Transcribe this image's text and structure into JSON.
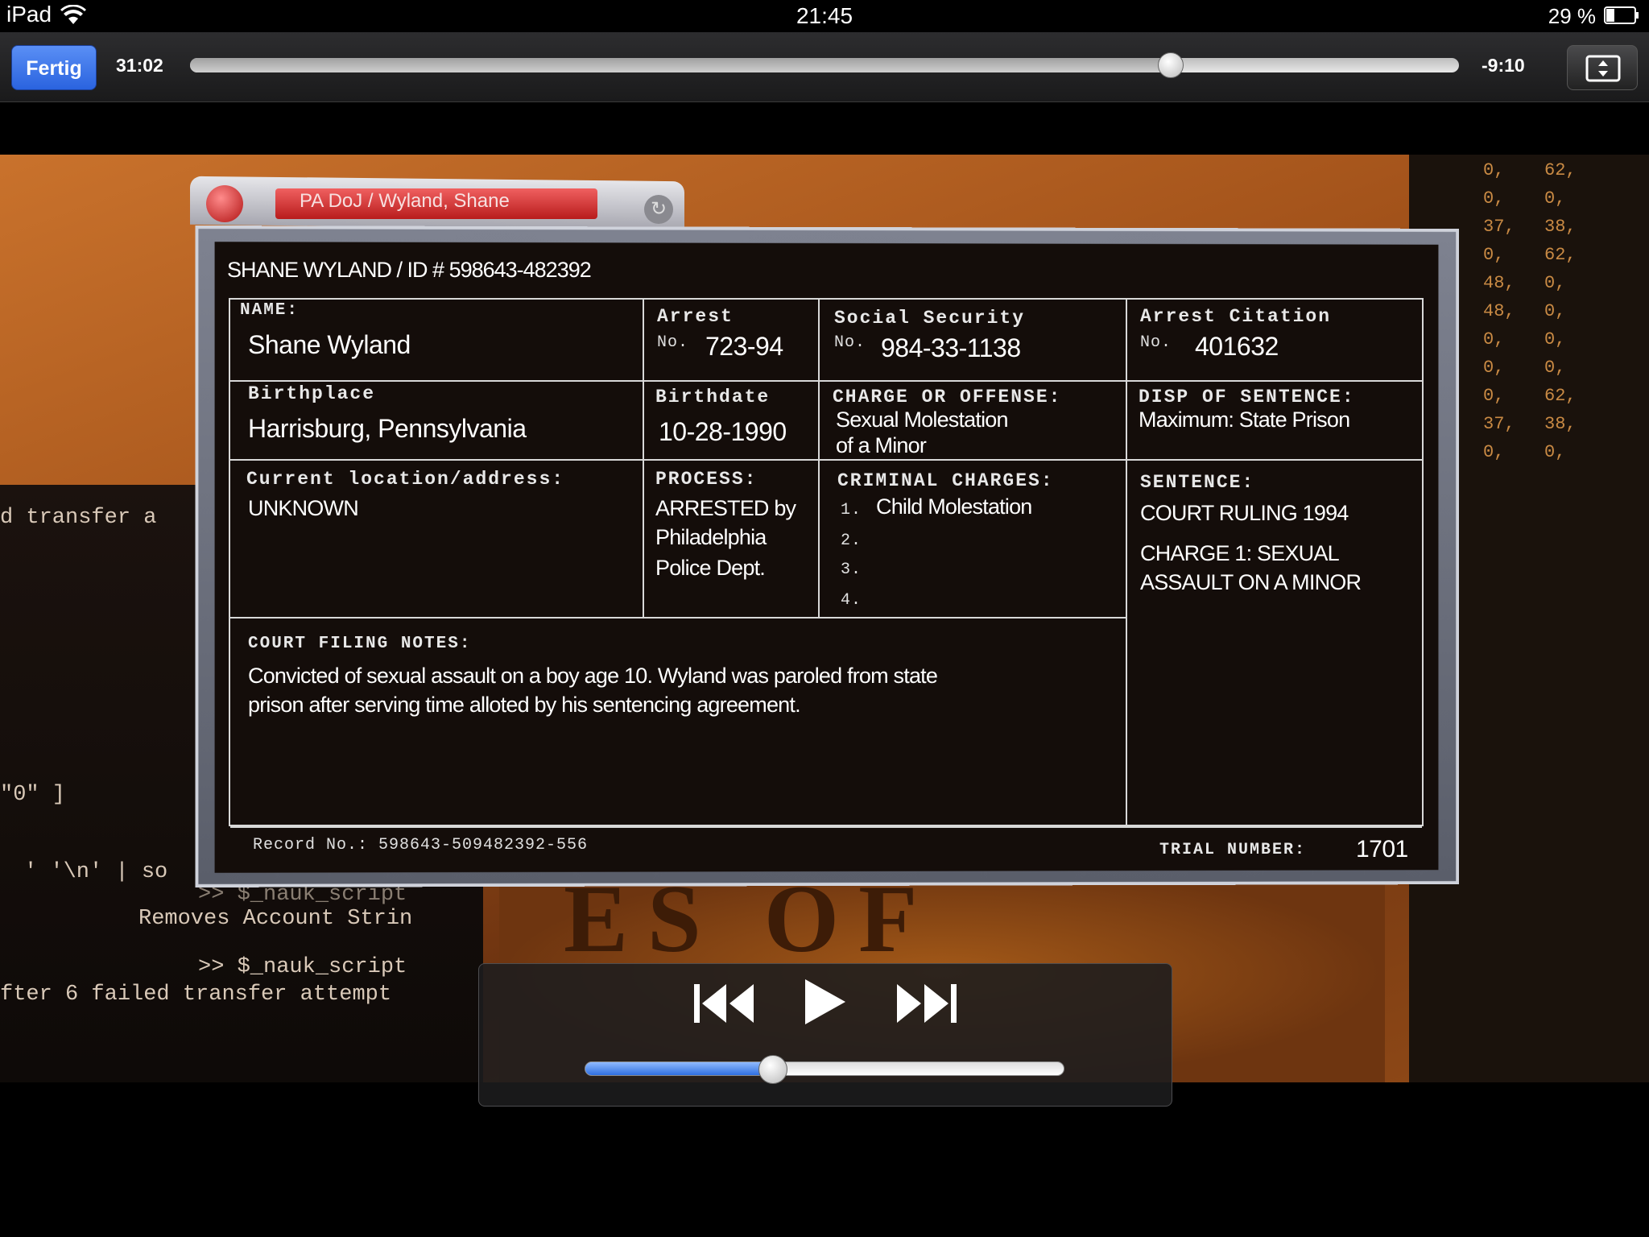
{
  "status_bar": {
    "device": "iPad",
    "time": "21:45",
    "battery_percent": "29 %",
    "battery_level": 0.29
  },
  "player": {
    "done_label": "Fertig",
    "elapsed": "31:02",
    "remaining": "-9:10",
    "progress": 0.772,
    "volume": 0.39
  },
  "video": {
    "window_title": "PA DoJ / Wyland, Shane",
    "record_header": "SHANE WYLAND / ID # 598643-482392",
    "fields": {
      "name_label": "NAME:",
      "name_value": "Shane Wyland",
      "arrest_label": "Arrest",
      "arrest_no": "No.",
      "arrest_value": "723-94",
      "ssn_label": "Social Security",
      "ssn_no": "No.",
      "ssn_value": "984-33-1138",
      "citation_label": "Arrest Citation",
      "citation_no": "No.",
      "citation_value": "401632",
      "birthplace_label": "Birthplace",
      "birthplace_value": "Harrisburg, Pennsylvania",
      "birthdate_label": "Birthdate",
      "birthdate_value": "10-28-1990",
      "charge_label": "CHARGE OR OFFENSE:",
      "charge_value_1": "Sexual Molestation",
      "charge_value_2": "of a Minor",
      "disp_label": "DISP OF SENTENCE:",
      "disp_value": "Maximum: State Prison",
      "location_label": "Current location/address:",
      "location_value": "UNKNOWN",
      "process_label": "PROCESS:",
      "process_lines": [
        "ARRESTED by",
        "Philadelphia",
        "Police Dept."
      ],
      "criminal_label": "CRIMINAL CHARGES:",
      "criminal_items": [
        "1.",
        "2.",
        "3.",
        "4."
      ],
      "criminal_first": "Child Molestation",
      "sentence_label": "SENTENCE:",
      "sentence_line_1": "COURT RULING 1994",
      "sentence_line_2": "CHARGE 1: SEXUAL",
      "sentence_line_3": "ASSAULT ON A MINOR",
      "notes_label": "COURT FILING NOTES:",
      "notes_line_1": "Convicted of sexual assault on a boy age 10. Wyland was paroled from state",
      "notes_line_2": "prison after serving time alloted by his sentencing agreement.",
      "record_no": "Record No.: 598643-509482392-556",
      "trial_label": "TRIAL NUMBER:",
      "trial_value": "1701"
    },
    "terminal_left": [
      "d transfer a",
      "\"0\" ]",
      "' '\\n' | so",
      ">> $_nauk_script",
      "Removes Account Strin",
      ">> $_nauk_script",
      "fter 6 failed transfer attempt"
    ],
    "terminal_right_cols": [
      [
        "0,",
        "0,",
        "37,",
        "0,",
        "48,",
        "48,",
        "0,",
        "0,",
        "0,",
        "37,",
        "0,"
      ],
      [
        "62,",
        "0,",
        "38,",
        "62,",
        "0,",
        "0,",
        "0,",
        "0,",
        "62,",
        "38,",
        "0,"
      ]
    ],
    "seal_text": "ES OF"
  }
}
